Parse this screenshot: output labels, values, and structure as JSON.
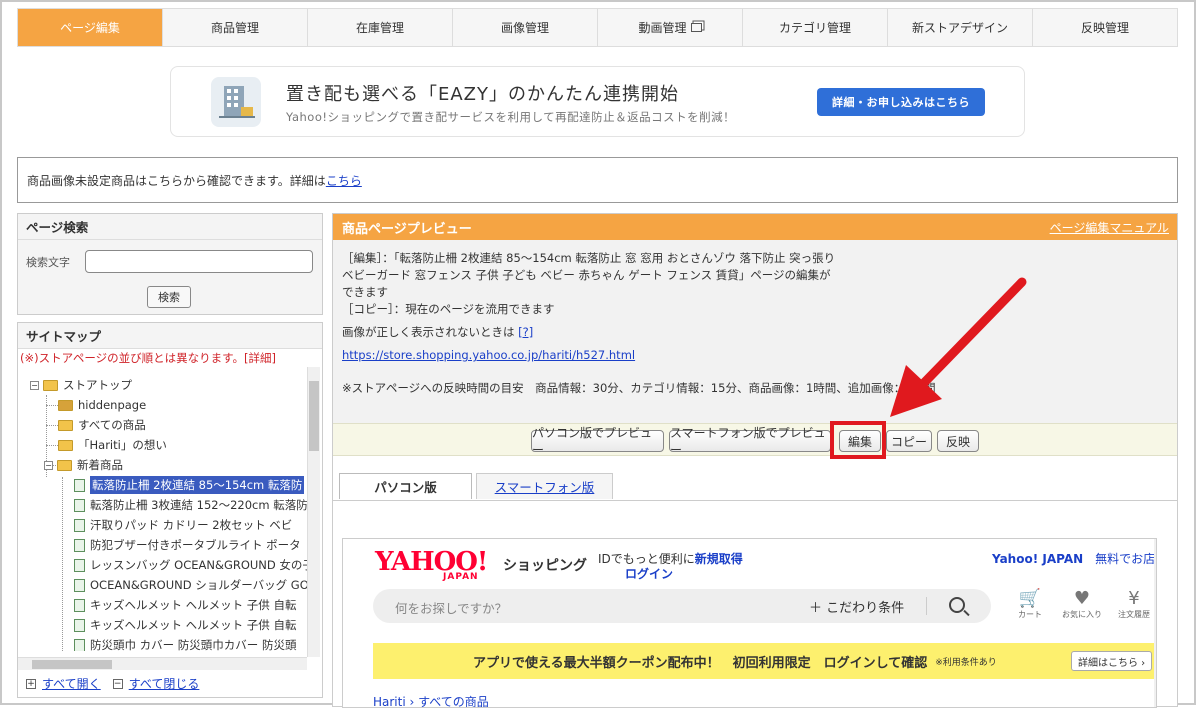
{
  "nav": {
    "tabs": [
      {
        "label": "ページ編集",
        "active": true
      },
      {
        "label": "商品管理"
      },
      {
        "label": "在庫管理"
      },
      {
        "label": "画像管理"
      },
      {
        "label": "動画管理"
      },
      {
        "label": "カテゴリ管理"
      },
      {
        "label": "新ストアデザイン"
      },
      {
        "label": "反映管理"
      }
    ]
  },
  "banner": {
    "title": "置き配も選べる「EAZY」のかんたん連携開始",
    "subtitle": "Yahoo!ショッピングで置き配サービスを利用して再配達防止＆返品コストを削減！",
    "button": "詳細・お申し込みはこちら"
  },
  "notice": {
    "text": "商品画像未設定商品はこちらから確認できます。詳細は",
    "link": "こちら"
  },
  "page_search": {
    "title": "ページ検索",
    "label": "検索文字",
    "value": "",
    "button": "検索"
  },
  "sitemap": {
    "title": "サイトマップ",
    "warning": "(※)ストアページの並び順とは異なります。[詳細]",
    "nodes": [
      {
        "label": "ストアトップ"
      },
      {
        "label": "hiddenpage"
      },
      {
        "label": "すべての商品"
      },
      {
        "label": "「Hariti」の想い"
      },
      {
        "label": "新着商品"
      },
      {
        "label": "転落防止柵 2枚連結 85～154cm 転落防"
      },
      {
        "label": "転落防止柵 3枚連結 152～220cm 転落防"
      },
      {
        "label": "汗取りパッド カドリー 2枚セット ベビ"
      },
      {
        "label": "防犯ブザー付きポータブルライト ポータ"
      },
      {
        "label": "レッスンバッグ OCEAN&GROUND 女の子"
      },
      {
        "label": "OCEAN&GROUND ショルダーバッグ GO"
      },
      {
        "label": "キッズヘルメット ヘルメット 子供 自転"
      },
      {
        "label": "キッズヘルメット ヘルメット 子供 自転"
      },
      {
        "label": "防災頭巾 カバー 防災頭巾カバー 防災頭"
      }
    ],
    "expand_all": "すべて開く",
    "collapse_all": "すべて閉じる"
  },
  "preview": {
    "title": "商品ページプレビュー",
    "manual": "ページ編集マニュアル",
    "desc_line1": "［編集］：「転落防止柵 2枚連結 85～154cm 転落防止 窓 窓用 おとさんゾウ 落下防止 突っ張り ベビーガード 窓フェンス 子供 子ども ベビー 赤ちゃん ゲート フェンス 賃貸」ページの編集ができます",
    "desc_line2": "［コピー］：現在のページを流用できます",
    "help_text": "画像が正しく表示されないときは",
    "help_link": "[?]",
    "url": "https://store.shopping.yahoo.co.jp/hariti/h527.html",
    "time_note": "※ストアページへの反映時間の目安　商品情報：30分、カテゴリ情報：15分、商品画像：1時間、追加画像：1時間",
    "buttons": {
      "pc_preview": "パソコン版でプレビュー",
      "sp_preview": "スマートフォン版でプレビュー",
      "edit": "編集",
      "copy": "コピー",
      "publish": "反映"
    },
    "tabs": {
      "pc": "パソコン版",
      "sp": "スマートフォン版"
    }
  },
  "yahoo_frame": {
    "logo": "YAHOO!",
    "logo_sub": "JAPAN",
    "shopping": "ショッピング",
    "id_text": "IDでもっと便利に",
    "id_link": "新規取得",
    "login": "ログイン",
    "japan_link": "Yahoo! JAPAN",
    "free_link": "無料でお店",
    "search_placeholder": "何をお探しですか？",
    "search_option": "＋ こだわり条件",
    "icons": [
      {
        "name": "cart-icon",
        "label": "カート"
      },
      {
        "name": "heart-icon",
        "label": "お気に入り"
      },
      {
        "name": "history-icon",
        "label": "注文履歴"
      }
    ],
    "coupon_text": "アプリで使える最大半額クーポン配布中！　初回利用限定　ログインして確認",
    "coupon_small": "※利用条件あり",
    "coupon_btn": "詳細はこちら ›",
    "breadcrumb": "Hariti › すべての商品"
  },
  "colors": {
    "accent": "#f5a443",
    "highlight": "#e0191e",
    "link": "#1a3fc8"
  }
}
